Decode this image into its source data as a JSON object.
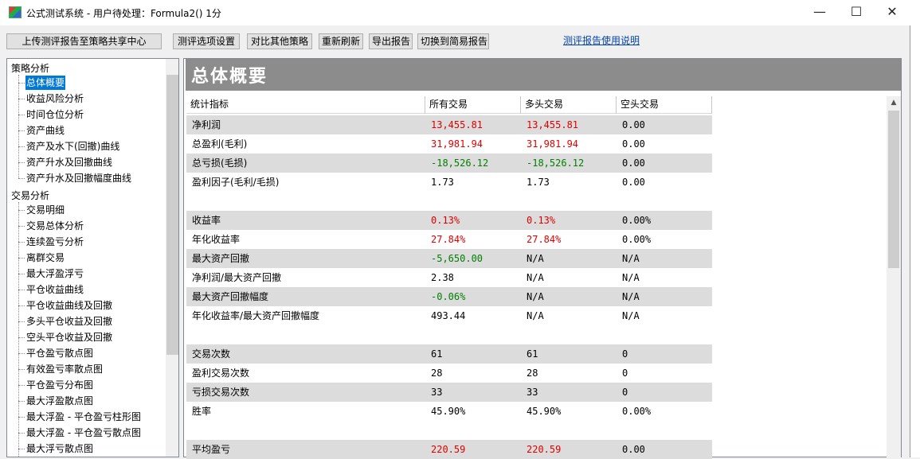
{
  "window": {
    "title": "公式测试系统 - 用户待处理：Formula2() 1分",
    "controls": {
      "minimize": "—",
      "maximize": "☐",
      "close": "✕"
    }
  },
  "toolbar": {
    "upload": "上传测评报告至策略共享中心",
    "options": "测评选项设置",
    "compare": "对比其他策略",
    "refresh": "重新刷新",
    "export": "导出报告",
    "switch": "切换到简易报告",
    "help_link": "测评报告使用说明"
  },
  "tree": {
    "group1": "策略分析",
    "group1_items": [
      "总体概要",
      "收益风险分析",
      "时间仓位分析",
      "资产曲线",
      "资产及水下(回撤)曲线",
      "资产升水及回撤曲线",
      "资产升水及回撤幅度曲线"
    ],
    "group2": "交易分析",
    "group2_items": [
      "交易明细",
      "交易总体分析",
      "连续盈亏分析",
      "离群交易",
      "最大浮盈浮亏",
      "平仓收益曲线",
      "平仓收益曲线及回撤",
      "多头平仓收益及回撤",
      "空头平仓收益及回撤",
      "平仓盈亏散点图",
      "有效盈亏率散点图",
      "平仓盈亏分布图",
      "最大浮盈散点图",
      "最大浮盈 - 平仓盈亏柱形图",
      "最大浮盈 - 平仓盈亏散点图",
      "最大浮亏散点图"
    ],
    "selected": "总体概要"
  },
  "report": {
    "title": "总体概要",
    "columns": [
      "统计指标",
      "所有交易",
      "多头交易",
      "空头交易"
    ],
    "rows": [
      {
        "label": "净利润",
        "all": "13,455.81",
        "long": "13,455.81",
        "short": "0.00",
        "tone": "pos",
        "shaded": true
      },
      {
        "label": "总盈利(毛利)",
        "all": "31,981.94",
        "long": "31,981.94",
        "short": "0.00",
        "tone": "pos",
        "shaded": false
      },
      {
        "label": "总亏损(毛损)",
        "all": "-18,526.12",
        "long": "-18,526.12",
        "short": "0.00",
        "tone": "neg",
        "shaded": true
      },
      {
        "label": "盈利因子(毛利/毛损)",
        "all": "1.73",
        "long": "1.73",
        "short": "0.00",
        "tone": "",
        "shaded": false
      },
      {
        "label": "",
        "all": "",
        "long": "",
        "short": "",
        "tone": "",
        "shaded": false
      },
      {
        "label": "收益率",
        "all": "0.13%",
        "long": "0.13%",
        "short": "0.00%",
        "tone": "pos",
        "shaded": true
      },
      {
        "label": "年化收益率",
        "all": "27.84%",
        "long": "27.84%",
        "short": "0.00%",
        "tone": "pos",
        "shaded": false
      },
      {
        "label": "最大资产回撤",
        "all": "-5,650.00",
        "long": "N/A",
        "short": "N/A",
        "tone": "neg",
        "shaded": true
      },
      {
        "label": "净利润/最大资产回撤",
        "all": "2.38",
        "long": "N/A",
        "short": "N/A",
        "tone": "",
        "shaded": false
      },
      {
        "label": "最大资产回撤幅度",
        "all": "-0.06%",
        "long": "N/A",
        "short": "N/A",
        "tone": "neg",
        "shaded": true
      },
      {
        "label": "年化收益率/最大资产回撤幅度",
        "all": "493.44",
        "long": "N/A",
        "short": "N/A",
        "tone": "",
        "shaded": false
      },
      {
        "label": "",
        "all": "",
        "long": "",
        "short": "",
        "tone": "",
        "shaded": false
      },
      {
        "label": "交易次数",
        "all": "61",
        "long": "61",
        "short": "0",
        "tone": "",
        "shaded": true
      },
      {
        "label": "盈利交易次数",
        "all": "28",
        "long": "28",
        "short": "0",
        "tone": "",
        "shaded": false
      },
      {
        "label": "亏损交易次数",
        "all": "33",
        "long": "33",
        "short": "0",
        "tone": "",
        "shaded": true
      },
      {
        "label": "胜率",
        "all": "45.90%",
        "long": "45.90%",
        "short": "0.00%",
        "tone": "",
        "shaded": false
      },
      {
        "label": "",
        "all": "",
        "long": "",
        "short": "",
        "tone": "",
        "shaded": false
      },
      {
        "label": "平均盈亏",
        "all": "220.59",
        "long": "220.59",
        "short": "0.00",
        "tone": "pos",
        "shaded": true
      }
    ]
  }
}
